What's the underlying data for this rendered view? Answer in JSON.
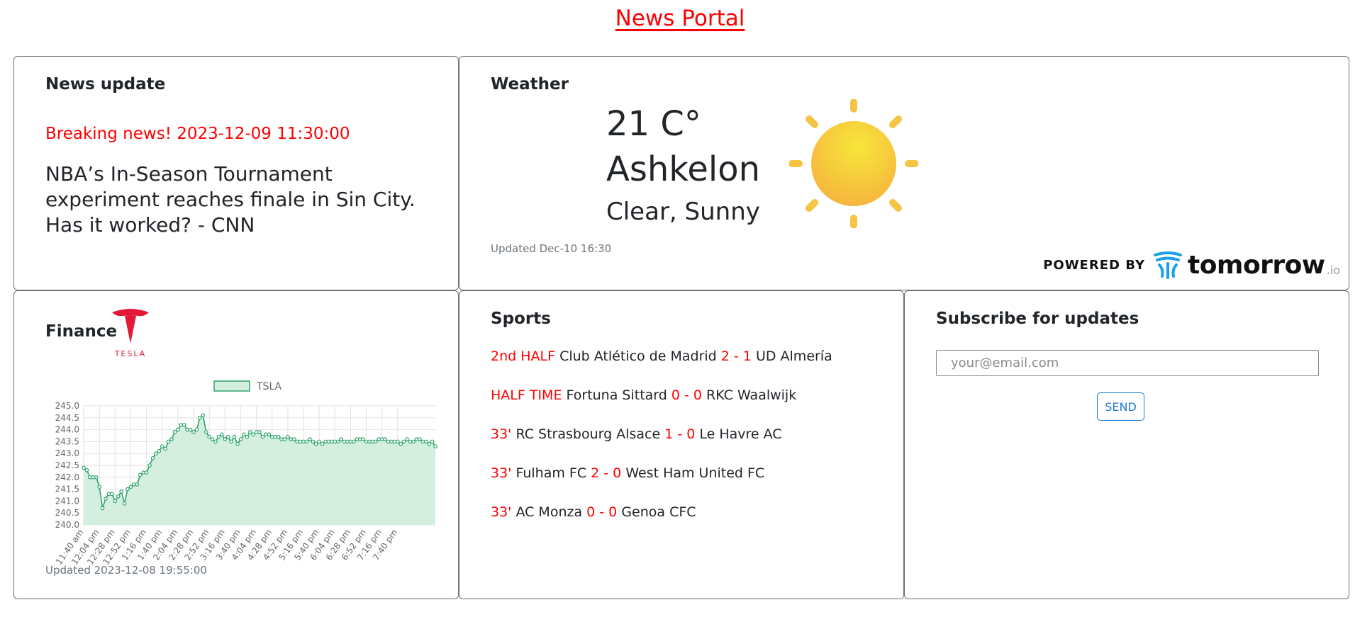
{
  "page": {
    "title": "News Portal"
  },
  "news": {
    "title": "News update",
    "breaking": "Breaking news! 2023-12-09 11:30:00",
    "headline": "NBA’s In-Season Tournament experiment reaches finale in Sin City. Has it worked? - CNN"
  },
  "weather": {
    "title": "Weather",
    "temperature": "21 C°",
    "city": "Ashkelon",
    "condition": "Clear, Sunny",
    "updated": "Updated Dec-10 16:30",
    "icon": "sun-icon",
    "powered_by": "POWERED BY",
    "provider": "tomorrow",
    "provider_suffix": ".io"
  },
  "finance": {
    "title": "Finance",
    "logo_text": "TESLA",
    "updated": "Updated 2023-12-08 19:55:00"
  },
  "sports": {
    "title": "Sports",
    "matches": [
      {
        "status": "2nd HALF",
        "home": "Club Atlético de Madrid",
        "score": "2 - 1",
        "away": "UD Almería"
      },
      {
        "status": "HALF TIME",
        "home": "Fortuna Sittard",
        "score": "0 - 0",
        "away": "RKC Waalwijk"
      },
      {
        "status": "33'",
        "home": "RC Strasbourg Alsace",
        "score": "1 - 0",
        "away": "Le Havre AC"
      },
      {
        "status": "33'",
        "home": "Fulham FC",
        "score": "2 - 0",
        "away": "West Ham United FC"
      },
      {
        "status": "33'",
        "home": "AC Monza",
        "score": "0 - 0",
        "away": "Genoa CFC"
      }
    ]
  },
  "subscribe": {
    "title": "Subscribe for updates",
    "placeholder": "your@email.com",
    "button": "SEND"
  },
  "colors": {
    "accent": "#ff0000",
    "chart_line": "#2ea36a",
    "chart_fill": "#d4eedf",
    "button": "#1f7ad0"
  },
  "chart_data": {
    "type": "area",
    "legend": [
      "TSLA"
    ],
    "x_tick_labels": [
      "11:40 am",
      "12:04 pm",
      "12:28 pm",
      "12:52 pm",
      "1:16 pm",
      "1:40 pm",
      "2:04 pm",
      "2:28 pm",
      "2:52 pm",
      "3:16 pm",
      "3:40 pm",
      "4:04 pm",
      "4:28 pm",
      "4:52 pm",
      "5:16 pm",
      "5:40 pm",
      "6:04 pm",
      "6:28 pm",
      "6:52 pm",
      "7:16 pm",
      "7:40 pm"
    ],
    "y_ticks": [
      240.0,
      240.5,
      241.0,
      241.5,
      242.0,
      242.5,
      243.0,
      243.5,
      244.0,
      244.5,
      245.0
    ],
    "ylim": [
      240.0,
      245.0
    ],
    "series": [
      {
        "name": "TSLA",
        "values": [
          242.4,
          242.3,
          242.0,
          242.0,
          242.0,
          241.6,
          240.7,
          241.1,
          241.3,
          241.3,
          241.0,
          241.2,
          241.4,
          240.9,
          241.5,
          241.6,
          241.7,
          241.7,
          242.1,
          242.2,
          242.2,
          242.5,
          242.8,
          243.0,
          243.1,
          243.3,
          243.2,
          243.5,
          243.6,
          243.9,
          244.0,
          244.2,
          244.2,
          244.0,
          244.0,
          243.9,
          244.0,
          244.5,
          244.6,
          243.9,
          243.7,
          243.6,
          243.5,
          243.7,
          243.8,
          243.6,
          243.7,
          243.5,
          243.7,
          243.4,
          243.6,
          243.8,
          243.7,
          243.9,
          243.8,
          243.9,
          243.9,
          243.7,
          243.8,
          243.8,
          243.7,
          243.7,
          243.7,
          243.6,
          243.6,
          243.7,
          243.6,
          243.6,
          243.5,
          243.5,
          243.5,
          243.5,
          243.6,
          243.5,
          243.4,
          243.5,
          243.4,
          243.5,
          243.5,
          243.5,
          243.5,
          243.5,
          243.6,
          243.5,
          243.5,
          243.5,
          243.5,
          243.6,
          243.6,
          243.6,
          243.5,
          243.5,
          243.5,
          243.5,
          243.6,
          243.6,
          243.6,
          243.5,
          243.5,
          243.5,
          243.5,
          243.4,
          243.5,
          243.6,
          243.5,
          243.5,
          243.6,
          243.6,
          243.5,
          243.5,
          243.4,
          243.5,
          243.3
        ]
      }
    ],
    "grid": true,
    "legend_position": "top-center"
  }
}
